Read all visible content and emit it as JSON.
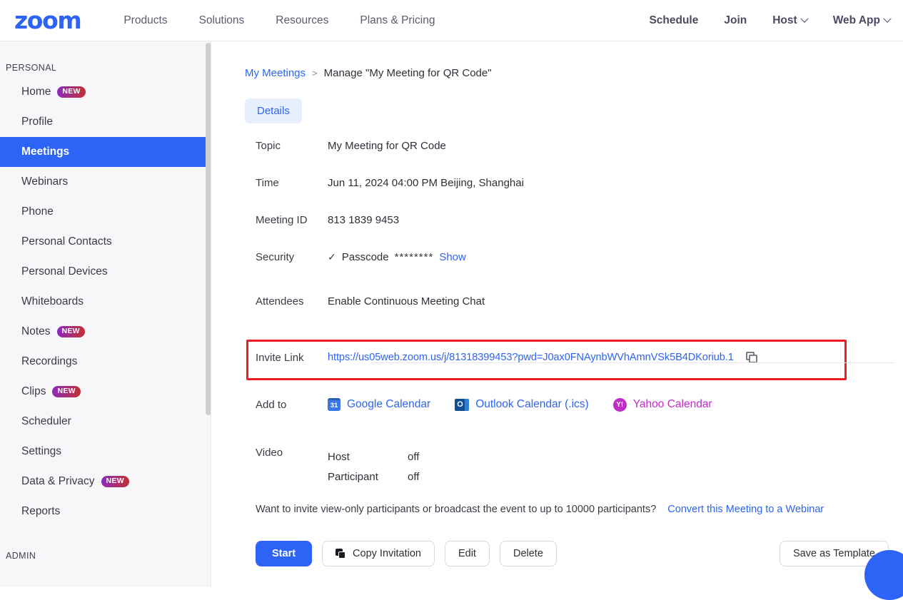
{
  "header": {
    "logo_text": "zoom",
    "nav_left": [
      {
        "label": "Products"
      },
      {
        "label": "Solutions"
      },
      {
        "label": "Resources"
      },
      {
        "label": "Plans & Pricing"
      }
    ],
    "nav_right": [
      {
        "label": "Schedule",
        "caret": false
      },
      {
        "label": "Join",
        "caret": false
      },
      {
        "label": "Host",
        "caret": true
      },
      {
        "label": "Web App",
        "caret": true
      }
    ]
  },
  "sidebar": {
    "section_personal": "PERSONAL",
    "section_admin": "ADMIN",
    "items": [
      {
        "label": "Home",
        "badge": "NEW",
        "active": false
      },
      {
        "label": "Profile",
        "badge": "",
        "active": false
      },
      {
        "label": "Meetings",
        "badge": "",
        "active": true
      },
      {
        "label": "Webinars",
        "badge": "",
        "active": false
      },
      {
        "label": "Phone",
        "badge": "",
        "active": false
      },
      {
        "label": "Personal Contacts",
        "badge": "",
        "active": false
      },
      {
        "label": "Personal Devices",
        "badge": "",
        "active": false
      },
      {
        "label": "Whiteboards",
        "badge": "",
        "active": false
      },
      {
        "label": "Notes",
        "badge": "NEW",
        "active": false
      },
      {
        "label": "Recordings",
        "badge": "",
        "active": false
      },
      {
        "label": "Clips",
        "badge": "NEW",
        "active": false
      },
      {
        "label": "Scheduler",
        "badge": "",
        "active": false
      },
      {
        "label": "Settings",
        "badge": "",
        "active": false
      },
      {
        "label": "Data & Privacy",
        "badge": "NEW",
        "active": false
      },
      {
        "label": "Reports",
        "badge": "",
        "active": false
      }
    ]
  },
  "breadcrumb": {
    "parent": "My Meetings",
    "separator": ">",
    "current": "Manage \"My Meeting for QR Code\""
  },
  "tabs": {
    "details": "Details"
  },
  "details": {
    "topic_label": "Topic",
    "topic_value": "My Meeting for QR Code",
    "time_label": "Time",
    "time_value": "Jun 11, 2024 04:00 PM Beijing, Shanghai",
    "meeting_id_label": "Meeting ID",
    "meeting_id_value": "813 1839 9453",
    "security_label": "Security",
    "security_check": "✓",
    "security_passcode_label": "Passcode",
    "security_passcode_mask": "********",
    "security_show_link": "Show",
    "attendees_label": "Attendees",
    "attendees_value": "Enable Continuous Meeting Chat",
    "invite_link_label": "Invite Link",
    "invite_link_url": "https://us05web.zoom.us/j/81318399453?pwd=J0ax0FNAynbWVhAmnVSk5B4DKoriub.1",
    "add_to_label": "Add to",
    "calendars": [
      {
        "label": "Google Calendar",
        "icon": "google-calendar-icon",
        "icon_text": "31"
      },
      {
        "label": "Outlook Calendar (.ics)",
        "icon": "outlook-calendar-icon",
        "icon_text": "O"
      },
      {
        "label": "Yahoo Calendar",
        "icon": "yahoo-calendar-icon",
        "icon_text": "Y!"
      }
    ],
    "video_label": "Video",
    "video_rows": [
      {
        "who": "Host",
        "state": "off"
      },
      {
        "who": "Participant",
        "state": "off"
      }
    ],
    "invite_note_text": "Want to invite view-only participants or broadcast the event to up to 10000 participants?",
    "invite_note_link": "Convert this Meeting to a Webinar"
  },
  "buttons": {
    "start": "Start",
    "copy_invitation": "Copy Invitation",
    "edit": "Edit",
    "delete": "Delete",
    "save_as_template": "Save as Template"
  },
  "colors": {
    "brand_blue": "#2D64F5",
    "highlight_red": "#ee1d24",
    "yahoo_magenta": "#C12BC6",
    "sidebar_bg": "#f7f7f9"
  }
}
